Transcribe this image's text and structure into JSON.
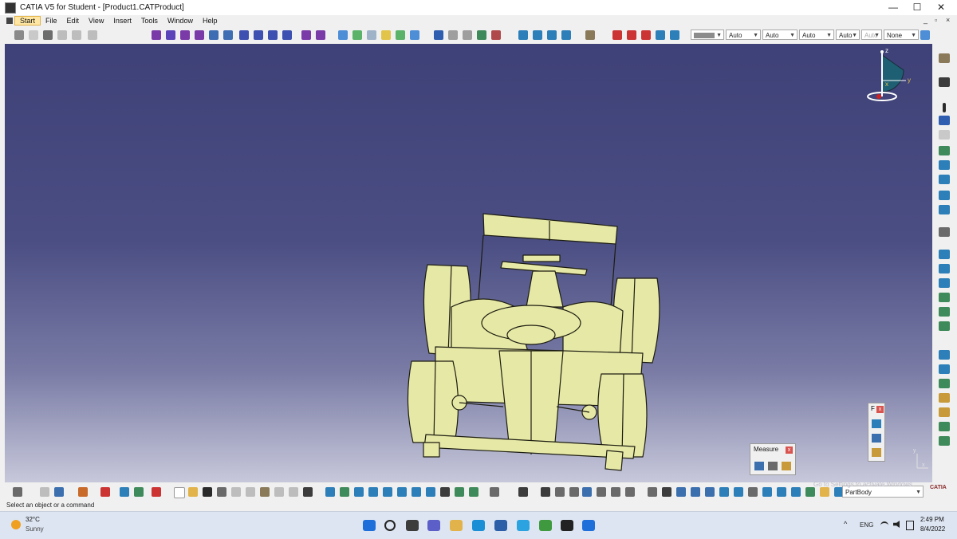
{
  "window": {
    "title": "CATIA V5 for Student - [Product1.CATProduct]",
    "controls": {
      "minimize": "—",
      "maximize": "☐",
      "close": "✕"
    },
    "mdi_controls": {
      "minimize": "_",
      "restore": "▫",
      "close": "×"
    }
  },
  "menu": {
    "items": [
      "Start",
      "File",
      "Edit",
      "View",
      "Insert",
      "Tools",
      "Window",
      "Help"
    ]
  },
  "toolbar_top": {
    "combos": [
      {
        "name": "color-combo",
        "value": ""
      },
      {
        "name": "transparency-combo",
        "value": "Auto"
      },
      {
        "name": "linetype-combo",
        "value": "Auto"
      },
      {
        "name": "thickness-combo",
        "value": "Auto"
      },
      {
        "name": "point-combo",
        "value": "Auto"
      },
      {
        "name": "layer-combo-disabled",
        "value": "Auto"
      },
      {
        "name": "layer-combo",
        "value": "None"
      }
    ]
  },
  "compass": {
    "x": "x",
    "y": "y",
    "z": "z"
  },
  "measure_panel": {
    "title": "Measure",
    "close": "x"
  },
  "small_panel": {
    "title": "F",
    "close": "x"
  },
  "axis_triad": {
    "y": "y",
    "x": "x"
  },
  "bottom": {
    "partbody_value": "PartBody",
    "watermark": "Go to Settings to activate Windows.",
    "catia_logo": "CATIA"
  },
  "statusbar": {
    "text": "Select an object or a command"
  },
  "taskbar": {
    "weather_temp": "32°C",
    "weather_desc": "Sunny",
    "language": "ENG",
    "time": "2:49 PM",
    "date": "8/4/2022",
    "tray_caret": "^"
  },
  "colors": {
    "viewport_top": "#3e4177",
    "viewport_bottom": "#c7c8da",
    "part_fill": "#e6e8a6",
    "part_stroke": "#1c1c10"
  }
}
